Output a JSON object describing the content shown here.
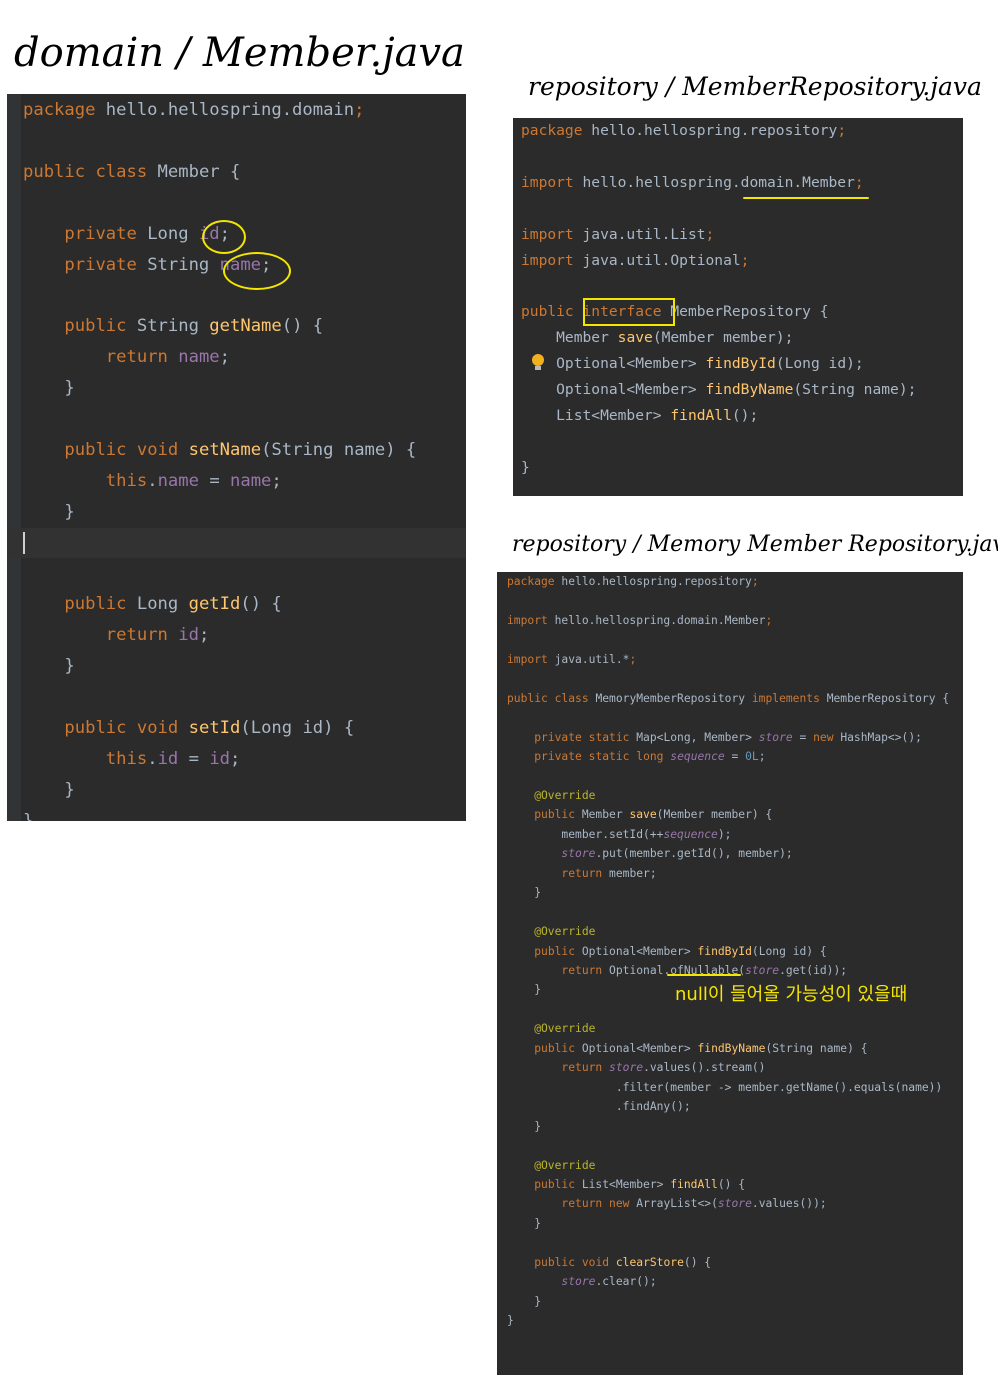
{
  "titles": {
    "member": "domain / Member.java",
    "member_repository": "repository / MemberRepository.java",
    "memory_repository": "repository / Memory Member Repository.java"
  },
  "member_java": [
    "package hello.hellospring.domain;",
    "",
    "public class Member {",
    "",
    "    private Long id;",
    "    private String name;",
    "",
    "    public String getName() {",
    "        return name;",
    "    }",
    "",
    "    public void setName(String name) {",
    "        this.name = name;",
    "    }",
    "",
    "",
    "    public Long getId() {",
    "        return id;",
    "    }",
    "",
    "    public void setId(Long id) {",
    "        this.id = id;",
    "    }",
    "}"
  ],
  "member_repository_java": [
    "package hello.hellospring.repository;",
    "",
    "import hello.hellospring.domain.Member;",
    "",
    "import java.util.List;",
    "import java.util.Optional;",
    "",
    "public interface MemberRepository {",
    "    Member save(Member member);",
    "    Optional<Member> findById(Long id);",
    "    Optional<Member> findByName(String name);",
    "    List<Member> findAll();",
    "",
    "}"
  ],
  "memory_repository_java": [
    "package hello.hellospring.repository;",
    "",
    "import hello.hellospring.domain.Member;",
    "",
    "import java.util.*;",
    "",
    "public class MemoryMemberRepository implements MemberRepository {",
    "",
    "    private static Map<Long, Member> store = new HashMap<>();",
    "    private static long sequence = 0L;",
    "",
    "    @Override",
    "    public Member save(Member member) {",
    "        member.setId(++sequence);",
    "        store.put(member.getId(), member);",
    "        return member;",
    "    }",
    "",
    "    @Override",
    "    public Optional<Member> findById(Long id) {",
    "        return Optional.ofNullable(store.get(id));",
    "    }",
    "",
    "    @Override",
    "    public Optional<Member> findByName(String name) {",
    "        return store.values().stream()",
    "                .filter(member -> member.getName().equals(name))",
    "                .findAny();",
    "    }",
    "",
    "    @Override",
    "    public List<Member> findAll() {",
    "        return new ArrayList<>(store.values());",
    "    }",
    "",
    "    public void clearStore() {",
    "        store.clear();",
    "    }",
    "}"
  ],
  "annotations": {
    "null_note": "null이 들어올 가능성이 있을때"
  },
  "colors": {
    "editor_bg": "#2b2b2b",
    "keyword": "#cc7832",
    "function": "#ffc66d",
    "field": "#9876aa",
    "text": "#a9b7c6",
    "highlight_marker": "#f5e600"
  }
}
